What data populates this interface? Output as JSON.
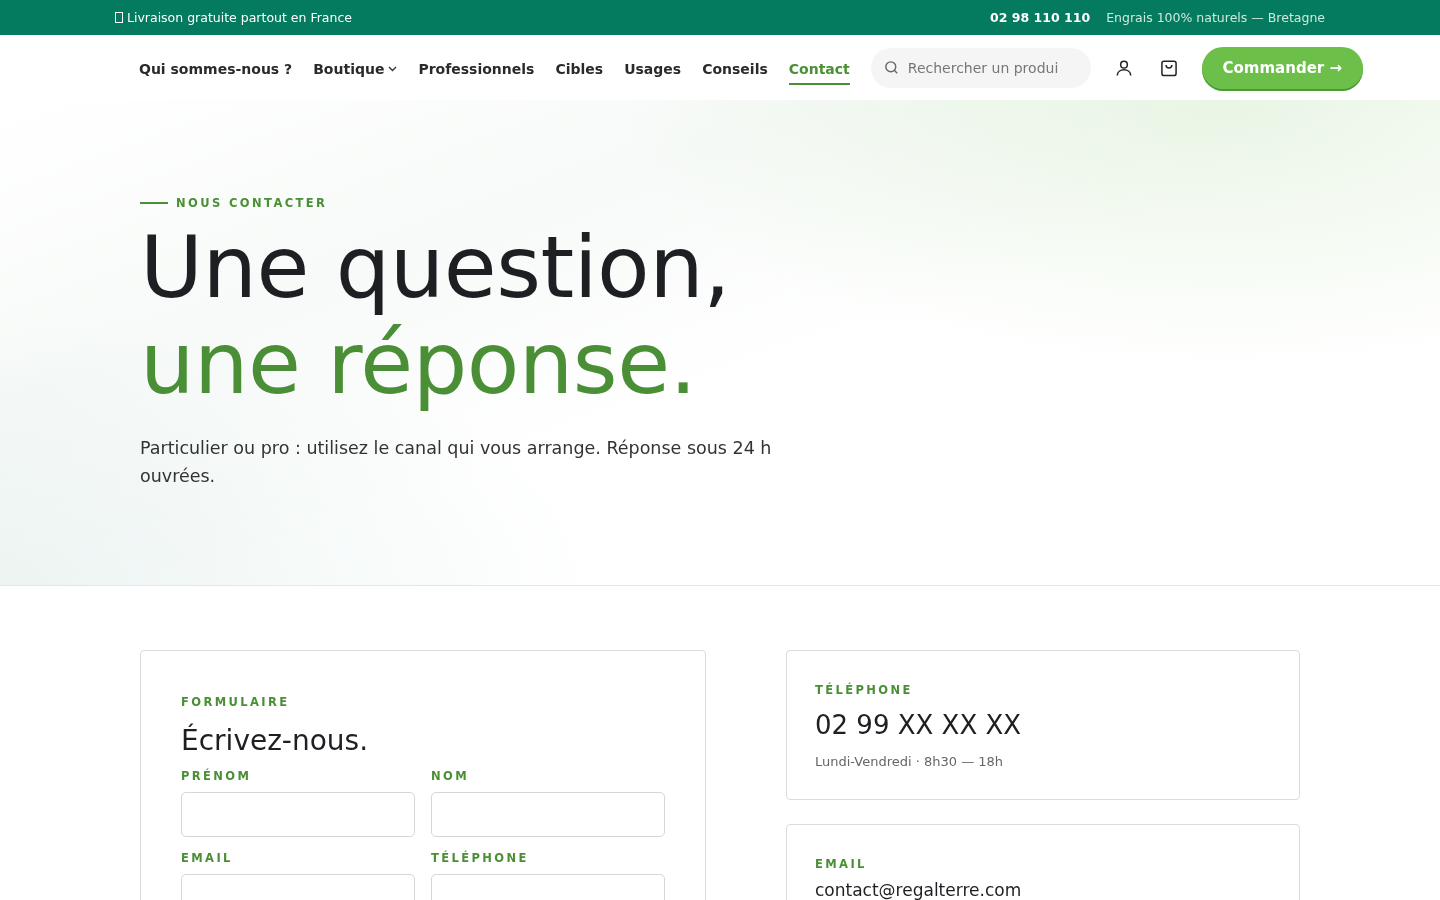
{
  "top_bar": {
    "shipping": "Livraison gratuite partout en France",
    "phone": "02 98 110 110",
    "tagline": "Engrais 100% naturels — Bretagne"
  },
  "nav": {
    "items": [
      {
        "label": "Qui sommes-nous ?",
        "selected": false,
        "dropdown": false
      },
      {
        "label": "Boutique",
        "selected": false,
        "dropdown": true
      },
      {
        "label": "Professionnels",
        "selected": false,
        "dropdown": false
      },
      {
        "label": "Cibles",
        "selected": false,
        "dropdown": false
      },
      {
        "label": "Usages",
        "selected": false,
        "dropdown": false
      },
      {
        "label": "Conseils",
        "selected": false,
        "dropdown": false
      },
      {
        "label": "Contact",
        "selected": true,
        "dropdown": false
      }
    ],
    "search": {
      "placeholder": "Rechercher un produi"
    },
    "cta": "Commander →"
  },
  "hero": {
    "eyebrow": "NOUS CONTACTER",
    "title_line_1": "Une question,",
    "title_line_2": "une réponse.",
    "intro": "Particulier ou pro : utilisez le canal qui vous arrange. Réponse sous 24 h ouvrées."
  },
  "form": {
    "eyebrow": "FORMULAIRE",
    "title": "Écrivez-nous.",
    "fields": [
      {
        "label": "PRÉNOM"
      },
      {
        "label": "NOM"
      },
      {
        "label": "EMAIL"
      },
      {
        "label": "TÉLÉPHONE"
      }
    ]
  },
  "contact_cards": [
    {
      "kind": "phone",
      "label": "TÉLÉPHONE",
      "value": "02 99 XX XX XX",
      "note": "Lundi-Vendredi · 8h30 — 18h"
    },
    {
      "kind": "email",
      "label": "EMAIL",
      "value": "contact@regalterre.com"
    }
  ]
}
